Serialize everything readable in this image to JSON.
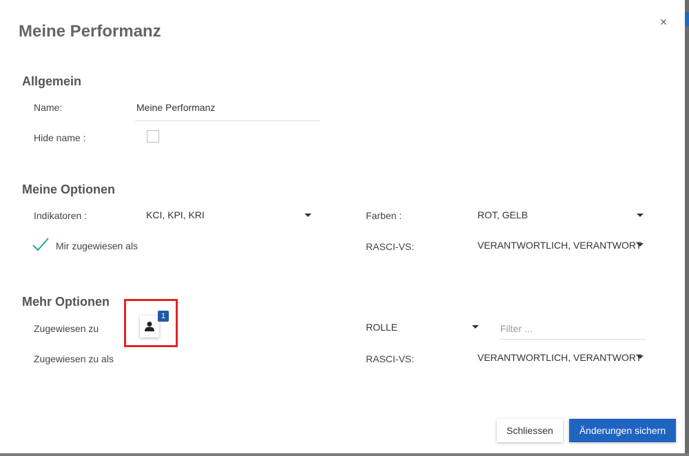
{
  "dialog": {
    "title": "Meine Performanz",
    "close_symbol": "×"
  },
  "allgemein": {
    "heading": "Allgemein",
    "name_label": "Name:",
    "name_value": "Meine Performanz",
    "hide_name_label": "Hide name :",
    "hide_name_checked": false
  },
  "meine_optionen": {
    "heading": "Meine Optionen",
    "indikatoren_label": "Indikatoren :",
    "indikatoren_value": "KCI, KPI, KRI",
    "farben_label": "Farben :",
    "farben_value": "ROT, GELB",
    "mir_zugewiesen_label": "Mir zugewiesen als",
    "rasci_label": "RASCI-VS:",
    "rasci_value": "VERANTWORTLICH, VERANTWORT"
  },
  "mehr_optionen": {
    "heading": "Mehr Optionen",
    "zugewiesen_zu_label": "Zugewiesen zu",
    "assigned_count": "1",
    "rolle_value": "ROLLE",
    "filter_placeholder": "Filter ...",
    "zugewiesen_als_label": "Zugewiesen zu als",
    "rasci_label": "RASCI-VS:",
    "rasci_value": "VERANTWORTLICH, VERANTWORT"
  },
  "footer": {
    "close_label": "Schliessen",
    "save_label": "Änderungen sichern"
  },
  "colors": {
    "accent": "#2064c2",
    "badge": "#2158a8",
    "check": "#26a69a",
    "highlight": "#e02424"
  },
  "icons": {
    "check": "check-icon",
    "user": "user-icon",
    "caret": "caret-down-icon",
    "close": "close-icon"
  }
}
